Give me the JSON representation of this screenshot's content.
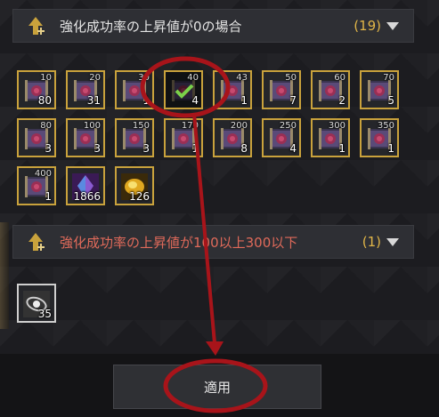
{
  "sections": [
    {
      "title": "強化成功率の上昇値が0の場合",
      "count": "(19)",
      "items": [
        {
          "top": "10",
          "qty": "80",
          "icon": "scroll-icon"
        },
        {
          "top": "20",
          "qty": "31",
          "icon": "scroll-icon"
        },
        {
          "top": "30",
          "qty": "1",
          "icon": "scroll-icon"
        },
        {
          "top": "40",
          "qty": "4",
          "icon": "scroll-icon",
          "selected": true
        },
        {
          "top": "43",
          "qty": "1",
          "icon": "scroll-icon"
        },
        {
          "top": "50",
          "qty": "7",
          "icon": "scroll-icon"
        },
        {
          "top": "60",
          "qty": "2",
          "icon": "scroll-icon"
        },
        {
          "top": "70",
          "qty": "5",
          "icon": "scroll-icon"
        },
        {
          "top": "80",
          "qty": "3",
          "icon": "scroll-icon"
        },
        {
          "top": "100",
          "qty": "3",
          "icon": "scroll-icon"
        },
        {
          "top": "150",
          "qty": "3",
          "icon": "scroll-icon"
        },
        {
          "top": "170",
          "qty": "1",
          "icon": "scroll-icon"
        },
        {
          "top": "200",
          "qty": "8",
          "icon": "scroll-icon"
        },
        {
          "top": "250",
          "qty": "4",
          "icon": "scroll-icon"
        },
        {
          "top": "300",
          "qty": "1",
          "icon": "scroll-icon"
        },
        {
          "top": "350",
          "qty": "1",
          "icon": "scroll-icon"
        },
        {
          "top": "400",
          "qty": "1",
          "icon": "scroll-icon"
        },
        {
          "top": "",
          "qty": "1866",
          "icon": "crystal-icon"
        },
        {
          "top": "",
          "qty": "126",
          "icon": "gold-gem-icon"
        }
      ]
    },
    {
      "title": "強化成功率の上昇値が100以上300以下",
      "count": "(1)",
      "items": [
        {
          "top": "",
          "qty": "35",
          "icon": "galaxy-stone-icon"
        }
      ]
    }
  ],
  "apply_label": "適用",
  "colors": {
    "gold_border": "#c9a23c",
    "count_gold": "#e0b548",
    "warning_red": "#e06a5a",
    "annotation_red": "#a8141a"
  }
}
